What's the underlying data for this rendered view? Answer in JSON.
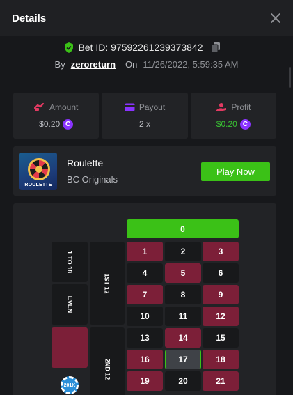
{
  "header": {
    "title": "Details"
  },
  "bet": {
    "id_text": "Bet ID: 97592261239373842",
    "by_label": "By",
    "user": "zeroreturn",
    "on_label": "On",
    "date": "11/26/2022, 5:59:35 AM"
  },
  "stats": {
    "amount": {
      "label": "Amount",
      "value": "$0.20",
      "coin": "C"
    },
    "payout": {
      "label": "Payout",
      "value": "2 x"
    },
    "profit": {
      "label": "Profit",
      "value": "$0.20",
      "coin": "C"
    }
  },
  "game": {
    "thumb_text": "ROULETTE",
    "name": "Roulette",
    "provider": "BC Originals",
    "play_label": "Play Now"
  },
  "board": {
    "zero": "0",
    "rows": [
      [
        "1",
        "2",
        "3"
      ],
      [
        "4",
        "5",
        "6"
      ],
      [
        "7",
        "8",
        "9"
      ],
      [
        "10",
        "11",
        "12"
      ],
      [
        "13",
        "14",
        "15"
      ],
      [
        "16",
        "17",
        "18"
      ],
      [
        "19",
        "20",
        "21"
      ]
    ],
    "red_numbers": [
      "1",
      "3",
      "5",
      "7",
      "9",
      "12",
      "14",
      "16",
      "18",
      "19",
      "21"
    ],
    "selected_number": "17",
    "side_bets": {
      "low": "1 TO 18",
      "even": "EVEN",
      "dozen1": "1ST 12",
      "dozen2": "2ND 12"
    },
    "chip_label": "201K"
  },
  "colors": {
    "green": "#3bc117",
    "red": "#7c1f38",
    "coin": "#8a33ff"
  }
}
